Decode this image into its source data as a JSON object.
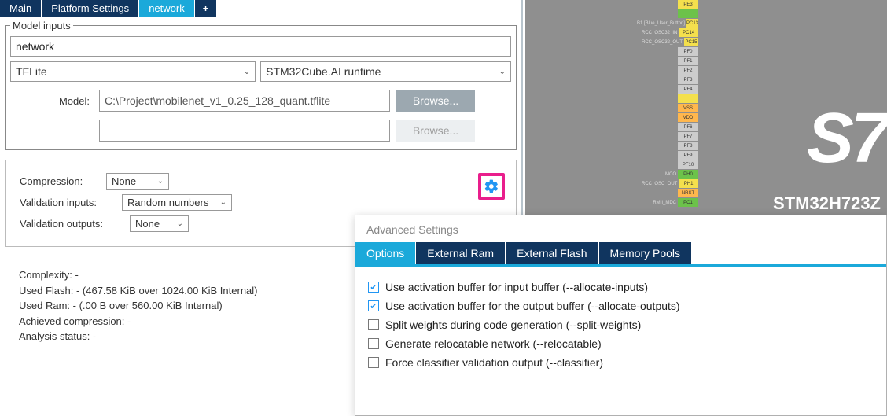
{
  "tabs": [
    {
      "label": "Main",
      "active": false
    },
    {
      "label": "Platform Settings",
      "active": false
    },
    {
      "label": "network",
      "active": true
    },
    {
      "label": "+",
      "add": true
    }
  ],
  "model_inputs": {
    "legend": "Model inputs",
    "name": "network",
    "framework": "TFLite",
    "runtime": "STM32Cube.AI runtime",
    "model_label": "Model:",
    "model_path": "C:\\Project\\mobilenet_v1_0.25_128_quant.tflite",
    "model_path2": "",
    "browse_label": "Browse..."
  },
  "settings": {
    "compression_label": "Compression:",
    "compression_value": "None",
    "val_inputs_label": "Validation inputs:",
    "val_inputs_value": "Random numbers",
    "val_outputs_label": "Validation outputs:",
    "val_outputs_value": "None"
  },
  "stats": {
    "complexity": "Complexity: -",
    "used_flash": "Used Flash: - (467.58 KiB over 1024.00 KiB Internal)",
    "used_ram": "Used Ram: - (.00 B over 560.00 KiB Internal)",
    "achieved": "Achieved compression: -",
    "analysis": "Analysis status: -"
  },
  "board": {
    "name": "STM32H723Z",
    "logo_text": "S7",
    "pins": [
      {
        "lbl": "",
        "txt": "PE3",
        "cls": "pin-y"
      },
      {
        "lbl": "",
        "txt": "",
        "cls": "pin-g"
      },
      {
        "lbl": "B1 [Blue_User_Button]",
        "txt": "PC13",
        "cls": "pin-y"
      },
      {
        "lbl": "RCC_OSC32_IN",
        "txt": "PC14",
        "cls": "pin-y"
      },
      {
        "lbl": "RCC_OSC32_OUT",
        "txt": "PC15",
        "cls": "pin-y"
      },
      {
        "lbl": "",
        "txt": "PF0",
        "cls": "pin-k"
      },
      {
        "lbl": "",
        "txt": "PF1",
        "cls": "pin-k"
      },
      {
        "lbl": "",
        "txt": "PF2",
        "cls": "pin-k"
      },
      {
        "lbl": "",
        "txt": "PF3",
        "cls": "pin-k"
      },
      {
        "lbl": "",
        "txt": "PF4",
        "cls": "pin-k"
      },
      {
        "lbl": "",
        "txt": "",
        "cls": "pin-y"
      },
      {
        "lbl": "",
        "txt": "VSS",
        "cls": "pin-o"
      },
      {
        "lbl": "",
        "txt": "VDD",
        "cls": "pin-o"
      },
      {
        "lbl": "",
        "txt": "PF6",
        "cls": "pin-k"
      },
      {
        "lbl": "",
        "txt": "PF7",
        "cls": "pin-k"
      },
      {
        "lbl": "",
        "txt": "PF8",
        "cls": "pin-k"
      },
      {
        "lbl": "",
        "txt": "PF9",
        "cls": "pin-k"
      },
      {
        "lbl": "",
        "txt": "PF10",
        "cls": "pin-k"
      },
      {
        "lbl": "MCO",
        "txt": "PH0",
        "cls": "pin-g"
      },
      {
        "lbl": "RCC_OSC_OUT",
        "txt": "PH1",
        "cls": "pin-y"
      },
      {
        "lbl": "",
        "txt": "NRST",
        "cls": "pin-o"
      },
      {
        "lbl": "RMII_MDC",
        "txt": "PC1",
        "cls": "pin-g"
      }
    ]
  },
  "advanced": {
    "title": "Advanced Settings",
    "tabs": [
      {
        "label": "Options",
        "active": true
      },
      {
        "label": "External Ram",
        "active": false
      },
      {
        "label": "External Flash",
        "active": false
      },
      {
        "label": "Memory Pools",
        "active": false
      }
    ],
    "options": [
      {
        "checked": true,
        "label": "Use activation buffer for input buffer (--allocate-inputs)"
      },
      {
        "checked": true,
        "label": "Use activation buffer for the output buffer (--allocate-outputs)"
      },
      {
        "checked": false,
        "label": "Split weights during code generation (--split-weights)"
      },
      {
        "checked": false,
        "label": "Generate relocatable network (--relocatable)"
      },
      {
        "checked": false,
        "label": "Force classifier validation output (--classifier)"
      }
    ]
  }
}
